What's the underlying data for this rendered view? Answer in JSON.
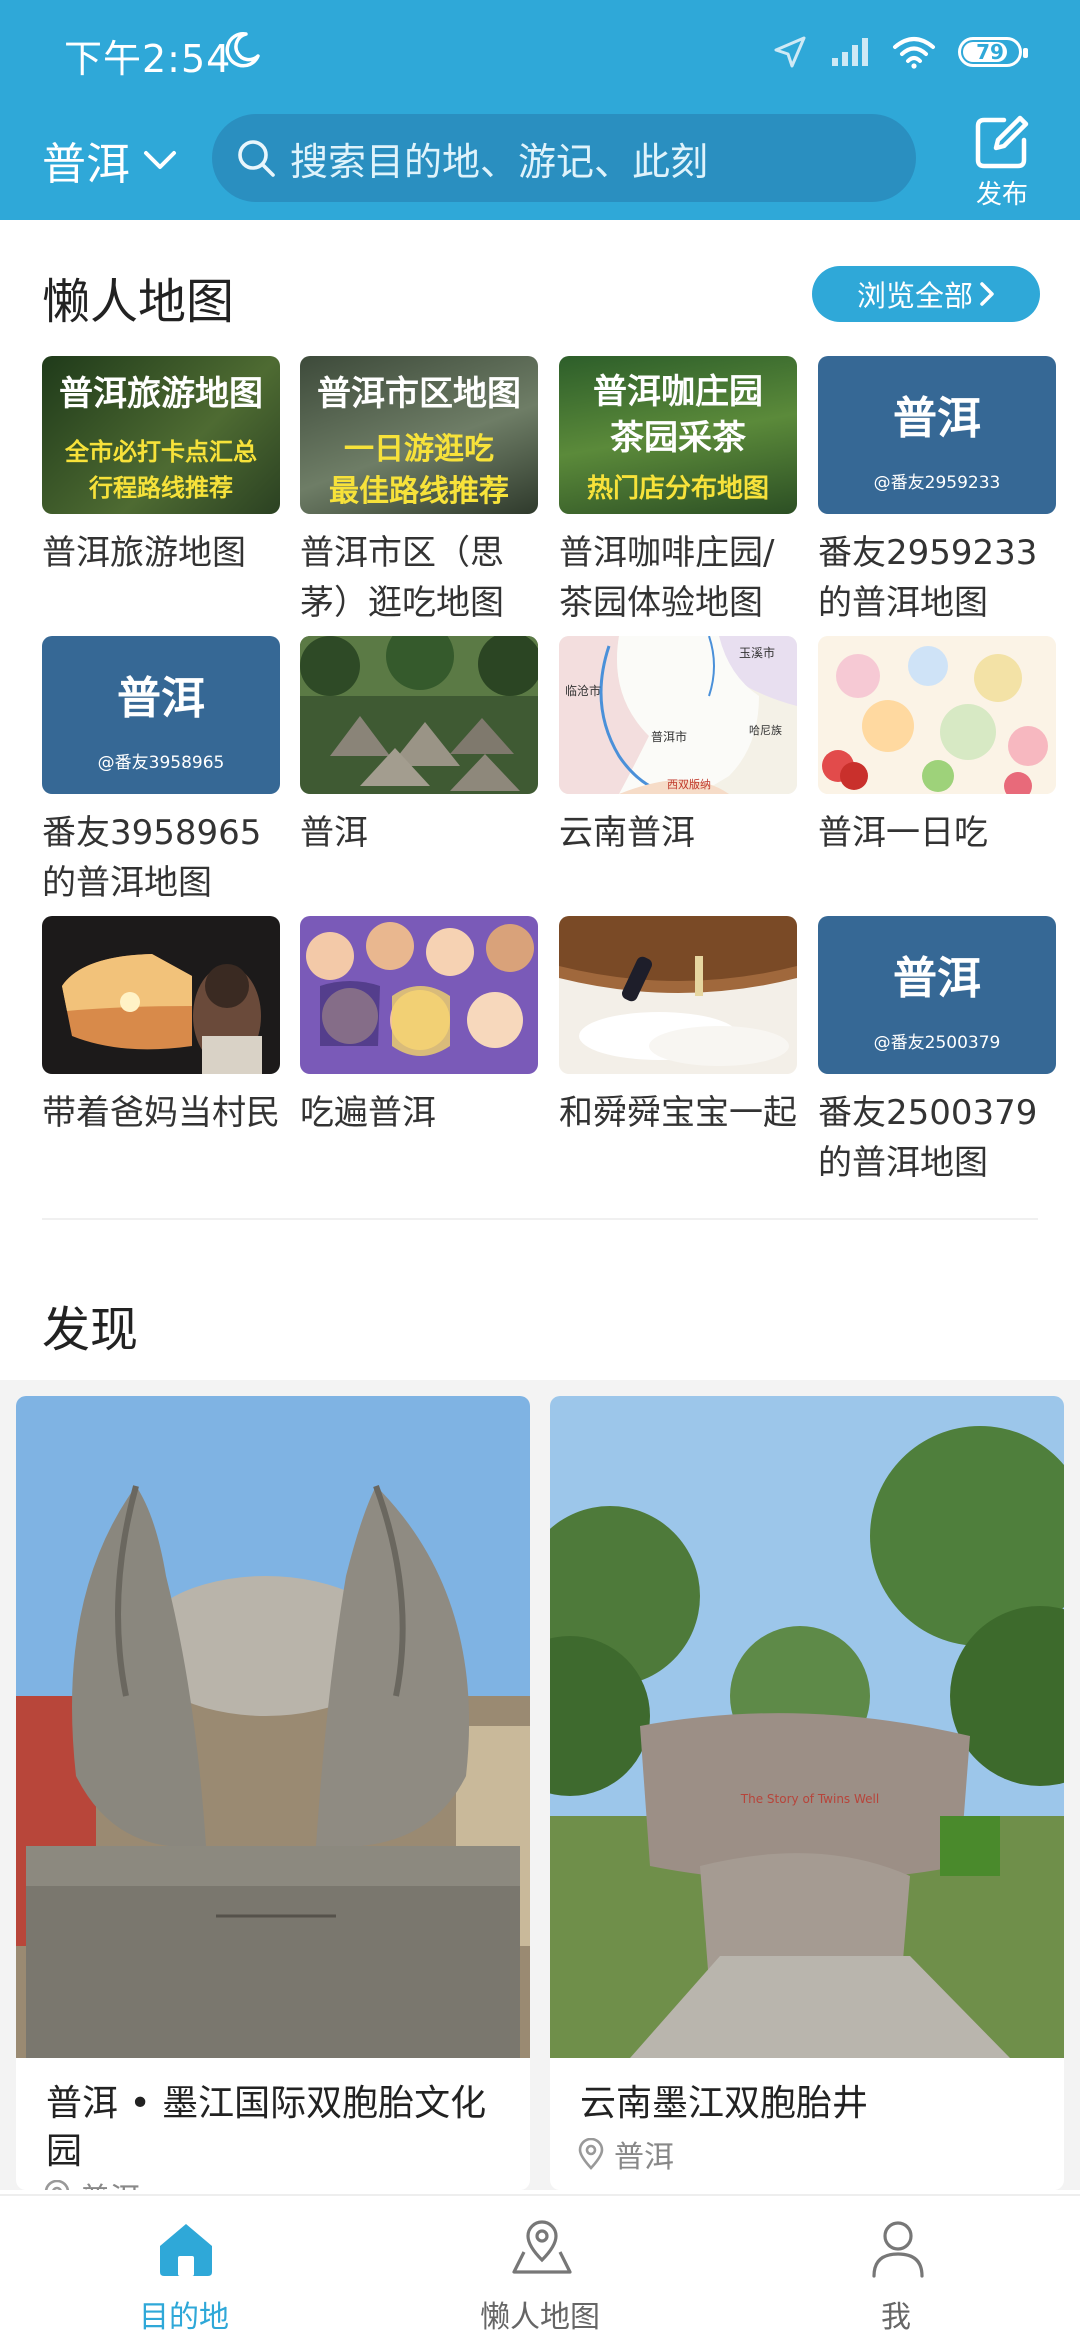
{
  "status_bar": {
    "time": "下午2:54",
    "battery": "79"
  },
  "header": {
    "city": "普洱",
    "search_placeholder": "搜索目的地、游记、此刻",
    "publish_label": "发布"
  },
  "lazy_maps": {
    "title": "懒人地图",
    "browse_all": "浏览全部",
    "items": [
      {
        "caption": "普洱旅游地图",
        "thumb_lines": [
          "普洱旅游地图",
          "全市必打卡点汇总",
          "行程路线推荐"
        ]
      },
      {
        "caption": "普洱市区（思茅）逛吃地图",
        "thumb_lines": [
          "普洱市区地图",
          "一日游逛吃",
          "最佳路线推荐"
        ]
      },
      {
        "caption": "普洱咖啡庄园/茶园体验地图",
        "thumb_lines": [
          "普洱咖庄园",
          "茶园采茶",
          "热门店分布地图"
        ]
      },
      {
        "caption": "番友2959233的普洱地图",
        "thumb_title": "普洱",
        "thumb_sub": "@番友2959233"
      },
      {
        "caption": "番友3958965的普洱地图",
        "thumb_title": "普洱",
        "thumb_sub": "@番友3958965"
      },
      {
        "caption": "普洱"
      },
      {
        "caption": "云南普洱",
        "map_labels": [
          "临沧市",
          "普洱市",
          "玉溪市",
          "哈尼族",
          "西双版纳"
        ]
      },
      {
        "caption": "普洱一日吃"
      },
      {
        "caption": "带着爸妈当村民"
      },
      {
        "caption": "吃遍普洱"
      },
      {
        "caption": "和舜舜宝宝一起"
      },
      {
        "caption": "番友2500379的普洱地图",
        "thumb_title": "普洱",
        "thumb_sub": "@番友2500379"
      }
    ]
  },
  "discover": {
    "title": "发现",
    "cards": [
      {
        "title": "普洱 • 墨江国际双胞胎文化园",
        "location": "普洱"
      },
      {
        "title": "云南墨江双胞胎井",
        "location": "普洱",
        "stone_text": "The Story of Twins Well"
      }
    ]
  },
  "tabbar": {
    "tabs": [
      {
        "label": "目的地",
        "active": true
      },
      {
        "label": "懒人地图",
        "active": false
      },
      {
        "label": "我",
        "active": false
      }
    ]
  },
  "colors": {
    "accent": "#2fa8d8",
    "header_bg": "#2fa8d8",
    "search_bg": "#2a8fc0"
  }
}
